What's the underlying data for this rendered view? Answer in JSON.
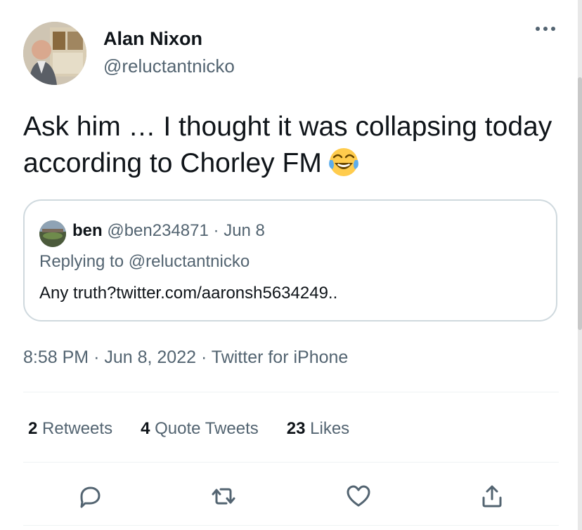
{
  "author": {
    "name": "Alan Nixon",
    "handle": "@reluctantnicko",
    "avatar_icon": "profile-photo"
  },
  "tweet": {
    "text": "Ask him … I thought it was collapsing today according to Chorley FM",
    "emoji": "face-with-tears-of-joy"
  },
  "quoted_tweet": {
    "name": "ben",
    "handle": "@ben234871",
    "date": "Jun 8",
    "reply_prefix": "Replying to ",
    "reply_handle": "@reluctantnicko",
    "text": "Any truth?twitter.com/aaronsh5634249.."
  },
  "meta": {
    "time": "8:58 PM",
    "date": "Jun 8, 2022",
    "source": "Twitter for iPhone",
    "separator": "·"
  },
  "stats": {
    "retweets_count": "2",
    "retweets_label": "Retweets",
    "quote_count": "4",
    "quote_label": "Quote Tweets",
    "likes_count": "23",
    "likes_label": "Likes"
  },
  "actions": [
    "reply-icon",
    "retweet-icon",
    "like-icon",
    "share-icon"
  ],
  "colors": {
    "text": "#0f1419",
    "secondary": "#536471",
    "border": "#cfd9de",
    "divider": "#eff3f4"
  }
}
